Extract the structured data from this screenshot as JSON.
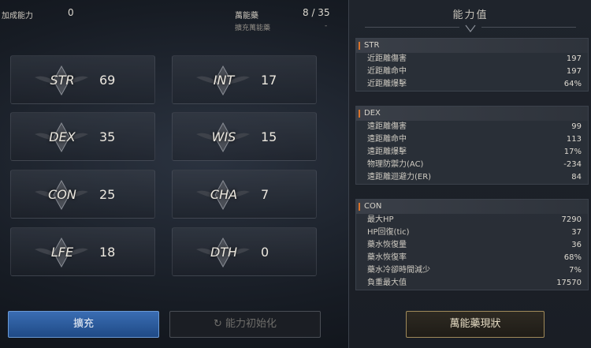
{
  "top": {
    "bonus_label": "加成能力",
    "bonus_value": "0",
    "elixir_label": "萬能藥",
    "elixir_value": "8 / 35",
    "elixir_sub_label": "擴充萬能藥",
    "elixir_sub_value": "-"
  },
  "stats": [
    {
      "name": "STR",
      "value": "69"
    },
    {
      "name": "INT",
      "value": "17"
    },
    {
      "name": "DEX",
      "value": "35"
    },
    {
      "name": "WIS",
      "value": "15"
    },
    {
      "name": "CON",
      "value": "25"
    },
    {
      "name": "CHA",
      "value": "7"
    },
    {
      "name": "LFE",
      "value": "18"
    },
    {
      "name": "DTH",
      "value": "0"
    }
  ],
  "panel": {
    "title": "能力值",
    "sections": [
      {
        "header": "STR",
        "rows": [
          {
            "label": "近距離傷害",
            "value": "197"
          },
          {
            "label": "近距離命中",
            "value": "197"
          },
          {
            "label": "近距離爆擊",
            "value": "64%"
          }
        ]
      },
      {
        "header": "DEX",
        "rows": [
          {
            "label": "遠距離傷害",
            "value": "99"
          },
          {
            "label": "遠距離命中",
            "value": "113"
          },
          {
            "label": "遠距離爆擊",
            "value": "17%"
          },
          {
            "label": "物理防禦力(AC)",
            "value": "-234"
          },
          {
            "label": "遠距離迴避力(ER)",
            "value": "84"
          }
        ]
      },
      {
        "header": "CON",
        "rows": [
          {
            "label": "最大HP",
            "value": "7290"
          },
          {
            "label": "HP回復(tic)",
            "value": "37"
          },
          {
            "label": "藥水恢復量",
            "value": "36"
          },
          {
            "label": "藥水恢復率",
            "value": "68%"
          },
          {
            "label": "藥水冷卻時間減少",
            "value": "7%"
          },
          {
            "label": "負重最大值",
            "value": "17570"
          }
        ]
      }
    ]
  },
  "buttons": {
    "expand": "擴充",
    "reset": "能力初始化",
    "potion": "萬能藥現狀"
  },
  "colors": {
    "accent_orange": "#d9732c",
    "button_blue": "#2a5ca0",
    "gold_border": "#a08a5a"
  },
  "icons": {
    "reset": "refresh-icon",
    "stat_emblem": "wings-emblem-icon"
  }
}
